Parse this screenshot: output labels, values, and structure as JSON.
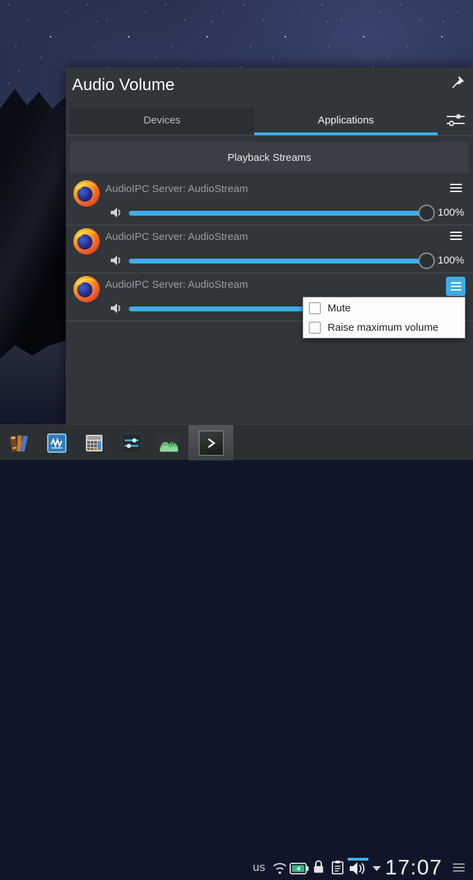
{
  "popup": {
    "title": "Audio Volume",
    "tabs": [
      {
        "label": "Devices",
        "active": false
      },
      {
        "label": "Applications",
        "active": true
      }
    ],
    "section_header": "Playback Streams",
    "streams": [
      {
        "app_icon": "firefox",
        "name": "AudioIPC Server: AudioStream",
        "volume": "100%",
        "menu_open": false
      },
      {
        "app_icon": "firefox",
        "name": "AudioIPC Server: AudioStream",
        "volume": "100%",
        "menu_open": false
      },
      {
        "app_icon": "firefox",
        "name": "AudioIPC Server: AudioStream",
        "volume": "",
        "menu_open": true
      }
    ],
    "context_menu": {
      "items": [
        {
          "label": "Mute",
          "checked": false
        },
        {
          "label": "Raise maximum volume",
          "checked": false
        }
      ]
    }
  },
  "taskbar": {
    "launchers": [
      {
        "icon": "calibre-books"
      },
      {
        "icon": "wave-app"
      },
      {
        "icon": "calculator"
      },
      {
        "icon": "audio-mixer"
      },
      {
        "icon": "landscape-app"
      },
      {
        "icon": "terminal",
        "active": true
      }
    ],
    "tray": {
      "keyboard_layout": "us",
      "icons": [
        "wifi",
        "battery-charging",
        "lock",
        "clipboard",
        "audio-volume"
      ],
      "clock": "17:07"
    }
  },
  "colors": {
    "accent": "#3daee9",
    "popup_bg": "#31363b",
    "menu_bg": "#fcfcfc",
    "menu_text": "#232627",
    "taskbar_bg": "#2c2f33",
    "stream_label": "#9b9ea1"
  }
}
